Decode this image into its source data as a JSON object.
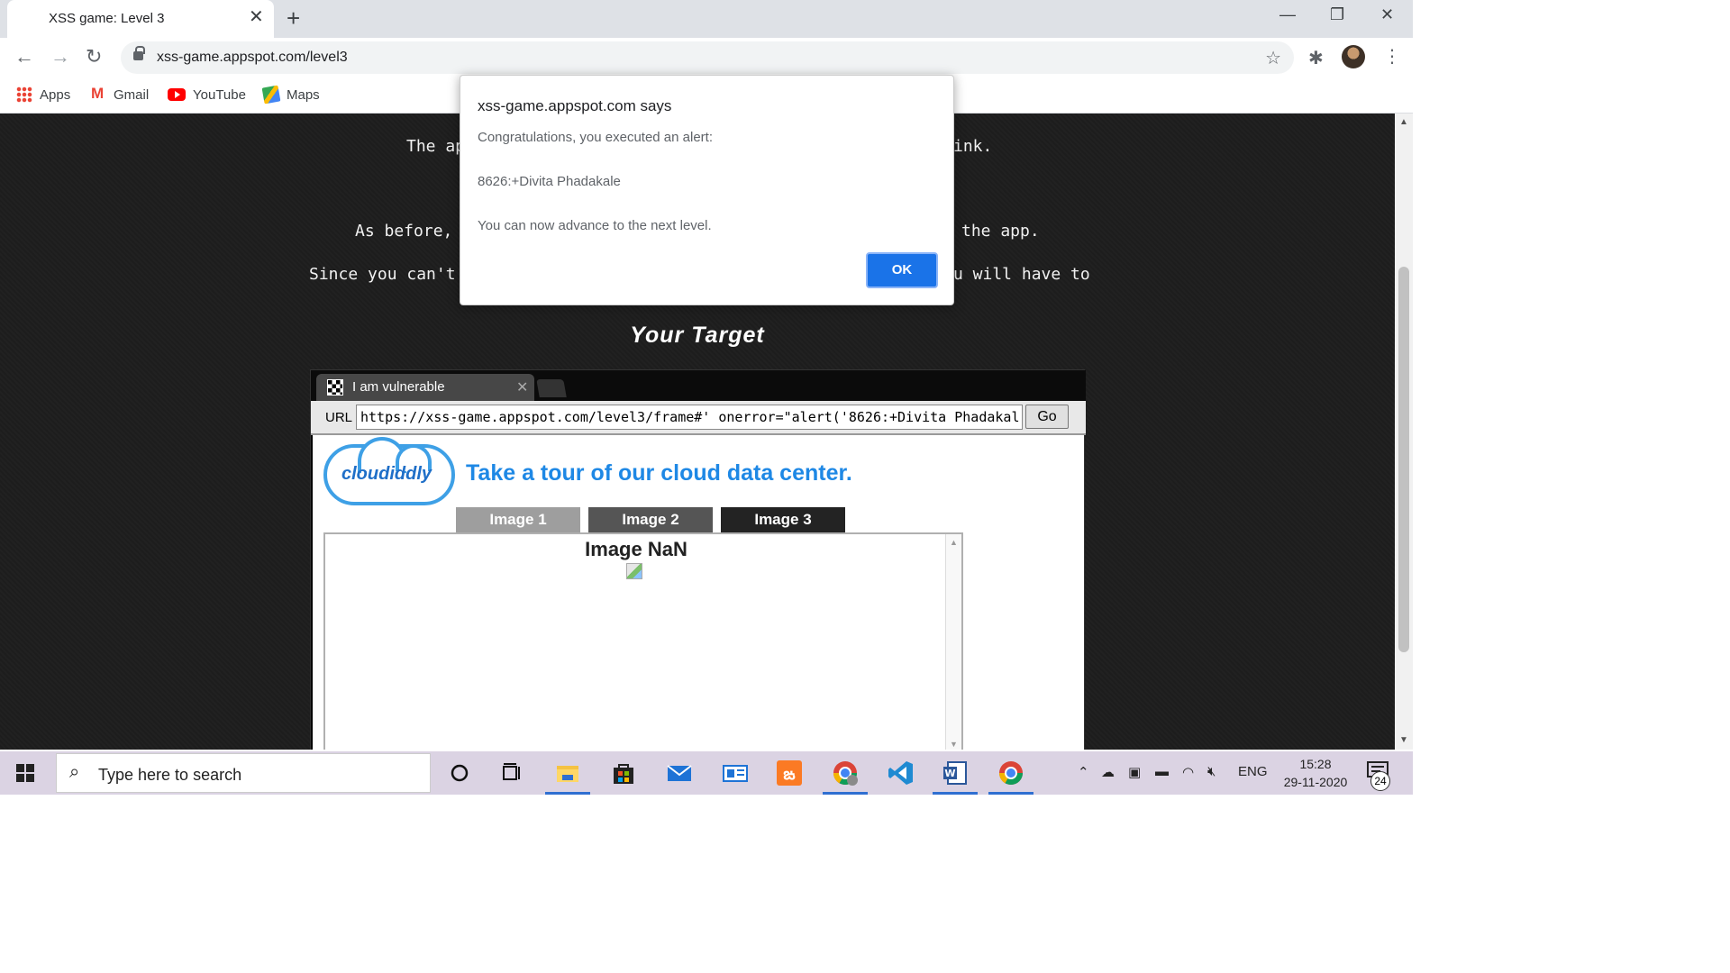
{
  "browser": {
    "tab_title": "XSS game: Level 3",
    "url": "xss-game.appspot.com/level3",
    "bookmarks": [
      {
        "label": "Apps"
      },
      {
        "label": "Gmail"
      },
      {
        "label": "YouTube"
      },
      {
        "label": "Maps"
      }
    ]
  },
  "page": {
    "line1_left": "The ap",
    "line1_right": "ink.",
    "line2_left": "As before,",
    "line2_right": "the app.",
    "line3_left": "Since you can't",
    "line3_right": "u will have to",
    "target_title": "Your Target"
  },
  "frame": {
    "tab_label": "I am vulnerable",
    "url_label": "URL",
    "url_value": "https://xss-game.appspot.com/level3/frame#' onerror=\"alert('8626:+Divita Phadakal",
    "go_label": "Go",
    "logo_text": "cloudiddly",
    "tour_text": "Take a tour of our cloud data center.",
    "image_tabs": [
      {
        "label": "Image 1",
        "color": "#9e9e9e"
      },
      {
        "label": "Image 2",
        "color": "#555555"
      },
      {
        "label": "Image 3",
        "color": "#232323"
      }
    ],
    "image_heading": "Image NaN"
  },
  "alert": {
    "title": "xss-game.appspot.com says",
    "line1": "Congratulations, you executed an alert:",
    "line2": "8626:+Divita Phadakale",
    "line3": "You can now advance to the next level.",
    "ok_label": "OK"
  },
  "taskbar": {
    "search_placeholder": "Type here to search",
    "language": "ENG",
    "time": "15:28",
    "date": "29-11-2020",
    "notification_count": "24"
  },
  "colors": {
    "accent": "#1a73e8",
    "page_bg": "#1d1d1d",
    "tour_blue": "#1e88e5"
  }
}
